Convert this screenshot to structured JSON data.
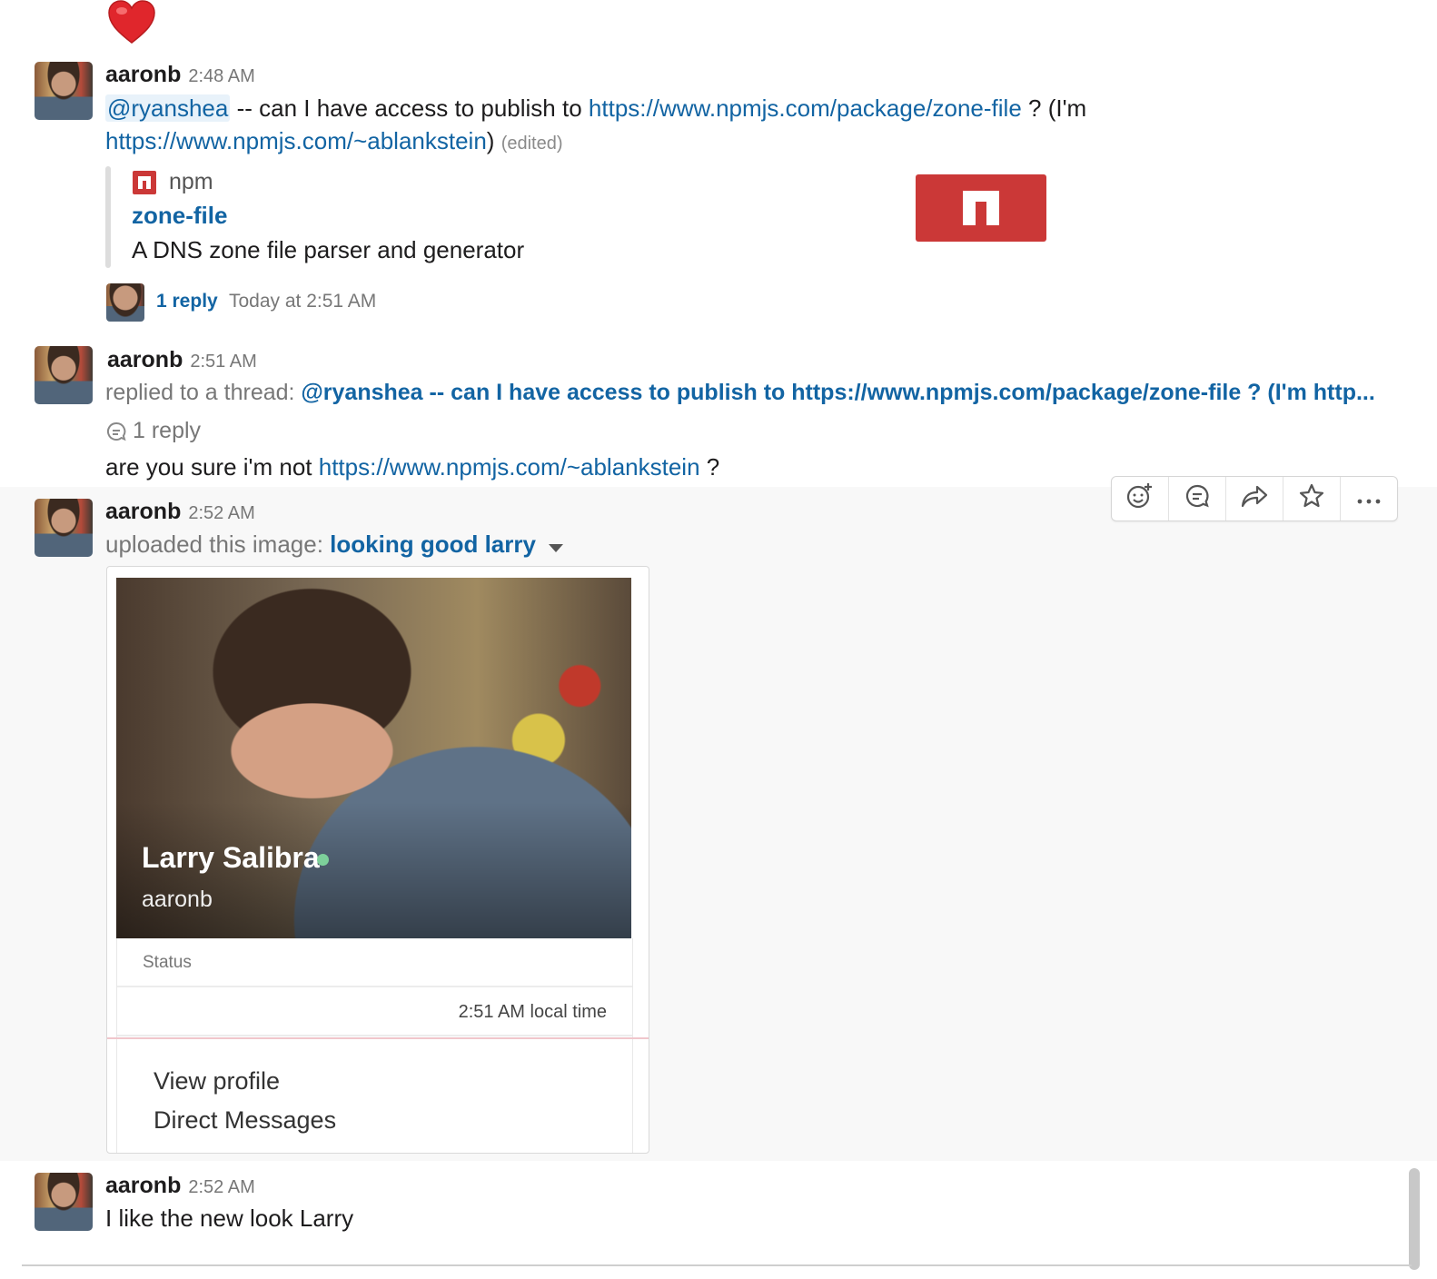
{
  "reaction": {
    "emoji": "❤️"
  },
  "messages": [
    {
      "user": "aaronb",
      "time": "2:48 AM",
      "mention": "@ryanshea",
      "text_mid": " -- can I have access to publish to ",
      "link1": "https://www.npmjs.com/package/zone-file",
      "text_after": " ? (I'm",
      "link2": "https://www.npmjs.com/~ablankstein",
      "text_close": ")",
      "edited": "(edited)",
      "attachment": {
        "service": "npm",
        "title": "zone-file",
        "description": "A DNS zone file parser and generator"
      },
      "thread": {
        "replies": "1 reply",
        "last_reply": "Today at 2:51 AM"
      }
    },
    {
      "user": "aaronb",
      "time": "2:51 AM",
      "replied_prefix": "replied to a thread: ",
      "replied_text": "@ryanshea -- can I have access to publish to https://www.npmjs.com/package/zone-file ? (I'm http...",
      "reply_count": "1 reply",
      "text": "are you sure i'm not ",
      "link": "https://www.npmjs.com/~ablankstein",
      "text_after": " ?"
    },
    {
      "user": "aaronb",
      "time": "2:52 AM",
      "upload_prefix": "uploaded this image: ",
      "image_title": "looking good larry",
      "image": {
        "profile_name": "Larry Salibra",
        "profile_handle": "aaronb",
        "status_label": "Status",
        "local_time": "2:51 AM local time",
        "menu": [
          "View profile",
          "Direct Messages"
        ]
      }
    },
    {
      "user": "aaronb",
      "time": "2:52 AM",
      "text": "I like the new look Larry"
    }
  ],
  "toolbar": {
    "icons": [
      "add-reaction-icon",
      "start-thread-icon",
      "share-icon",
      "star-icon",
      "more-actions-icon"
    ]
  },
  "colors": {
    "link": "#1264a3",
    "npm_red": "#cb3837",
    "presence": "#7dd09a"
  }
}
